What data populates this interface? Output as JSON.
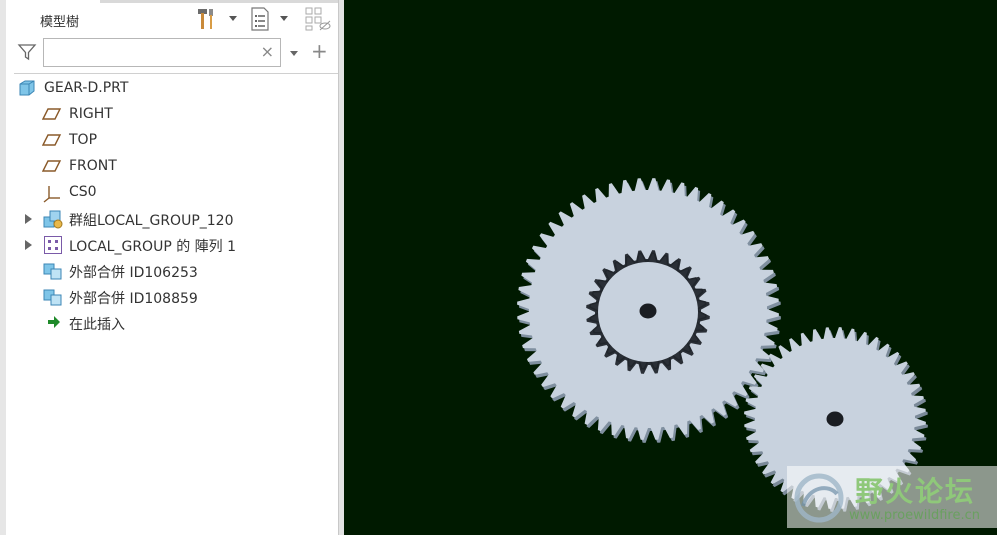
{
  "model_tree": {
    "title": "模型樹",
    "search": {
      "value": "",
      "clear_symbol": "×"
    },
    "add_symbol": "+",
    "items": [
      {
        "label": "GEAR-D.PRT",
        "icon": "part-icon",
        "expandable": false
      },
      {
        "label": "RIGHT",
        "icon": "datum-plane-icon",
        "expandable": false
      },
      {
        "label": "TOP",
        "icon": "datum-plane-icon",
        "expandable": false
      },
      {
        "label": "FRONT",
        "icon": "datum-plane-icon",
        "expandable": false
      },
      {
        "label": "CS0",
        "icon": "coordinate-system-icon",
        "expandable": false
      },
      {
        "label": "群組LOCAL_GROUP_120",
        "icon": "group-icon",
        "expandable": true
      },
      {
        "label": "LOCAL_GROUP 的 陣列 1",
        "icon": "pattern-icon",
        "expandable": true
      },
      {
        "label": "外部合併 ID106253",
        "icon": "external-merge-icon",
        "expandable": false
      },
      {
        "label": "外部合併 ID108859",
        "icon": "external-merge-icon",
        "expandable": false
      },
      {
        "label": "在此插入",
        "icon": "insert-here-arrow-icon",
        "expandable": false
      }
    ]
  },
  "viewport": {
    "background": "#001a00",
    "gear_color": "#c8d2de",
    "gears": [
      {
        "name": "large-gear",
        "teeth": 56
      },
      {
        "name": "inner-ring-gear",
        "teeth": 28
      },
      {
        "name": "small-gear",
        "teeth": 44
      }
    ]
  },
  "watermark": {
    "title": "野火论坛",
    "url": "www.proewildfire.cn"
  }
}
